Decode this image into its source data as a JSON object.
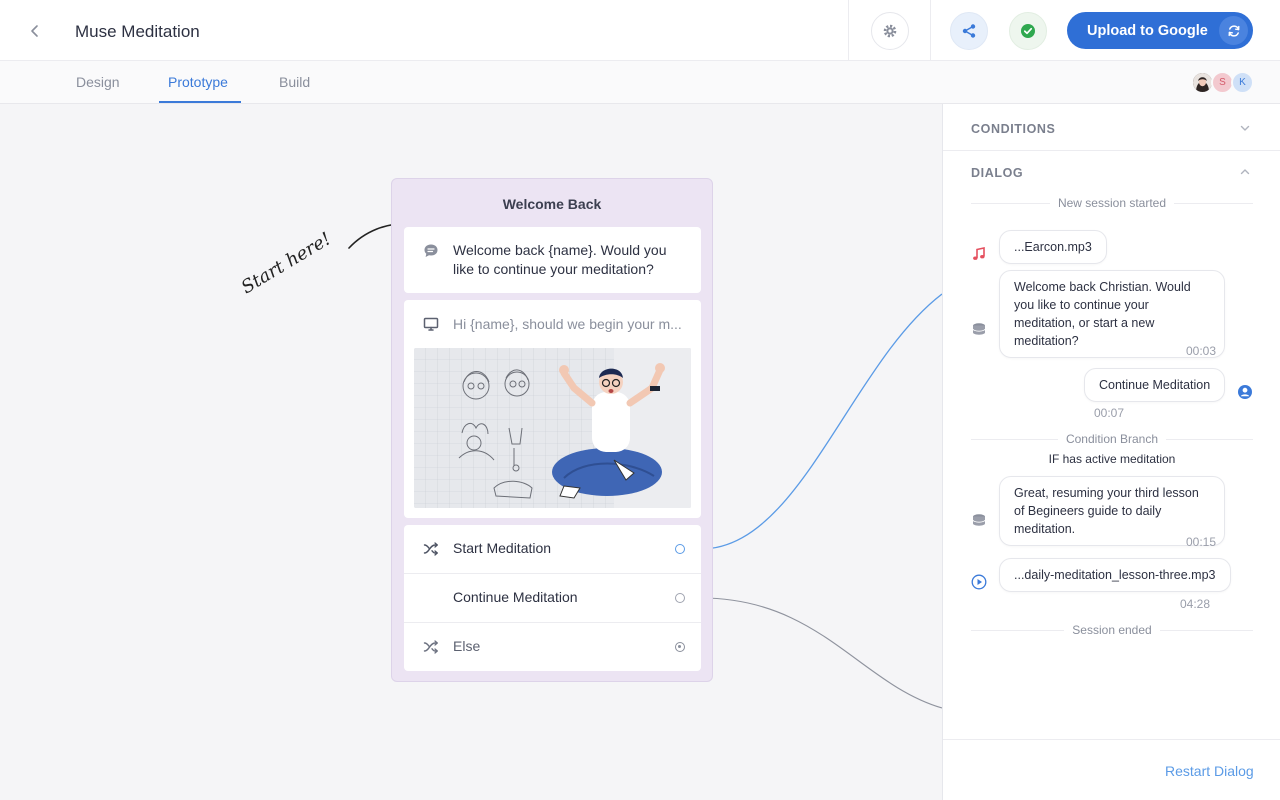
{
  "header": {
    "back_icon": "chevron-left-icon",
    "title": "Muse Meditation",
    "settings_icon": "gear-icon",
    "share_icon": "share-icon",
    "status_icon": "check-circle-icon",
    "upload_label": "Upload to Google",
    "sync_icon": "sync-icon"
  },
  "tabs": [
    {
      "label": "Design"
    },
    {
      "label": "Prototype",
      "active": true
    },
    {
      "label": "Build"
    }
  ],
  "collaborators": [
    {
      "initial": "",
      "kind": "photo"
    },
    {
      "initial": "S",
      "color": "#f3c9cf",
      "text_color": "#d45a6a"
    },
    {
      "initial": "K",
      "color": "#cfe0f7",
      "text_color": "#3b7ad9"
    }
  ],
  "canvas": {
    "annotation": "Start here!",
    "node": {
      "title": "Welcome Back",
      "speech_text": "Welcome back {name}. Would you like to continue your meditation?",
      "display_text": "Hi {name}, should we begin your m...",
      "choices": [
        {
          "label": "Start Meditation",
          "icon": "shuffle-icon",
          "connected": true
        },
        {
          "label": "Continue Meditation",
          "icon": "",
          "connected": true
        },
        {
          "label": "Else",
          "icon": "shuffle-crossed-icon",
          "connected": false
        }
      ]
    }
  },
  "panel": {
    "conditions_title": "CONDITIONS",
    "dialog_title": "DIALOG",
    "session_started": "New session started",
    "messages": [
      {
        "text": "...Earcon.mp3",
        "icon": "music-note-icon",
        "side": "left"
      },
      {
        "text": "Welcome back Christian. Would you like to continue your meditation, or start a new meditation?",
        "icon": "speaker-icon",
        "side": "left",
        "time": "00:03"
      },
      {
        "text": "Continue Meditation",
        "icon": "user-icon",
        "side": "right",
        "time": "00:07"
      },
      {
        "text": "Great, resuming your third lesson of Begineers guide to daily meditation.",
        "icon": "speaker-icon",
        "side": "left",
        "time": "00:15"
      },
      {
        "text": "...daily-meditation_lesson-three.mp3",
        "icon": "play-circle-icon",
        "side": "left",
        "time": "04:28"
      }
    ],
    "condition_branch": "Condition Branch",
    "condition_text": "IF has active meditation",
    "session_ended": "Session ended",
    "restart_label": "Restart Dialog"
  },
  "colors": {
    "accent": "#3b7ad9",
    "upload_bg": "#2f6fd6",
    "node_bg": "#ece4f3",
    "wire_blue": "#5b9be6",
    "wire_gray": "#8f939e"
  }
}
